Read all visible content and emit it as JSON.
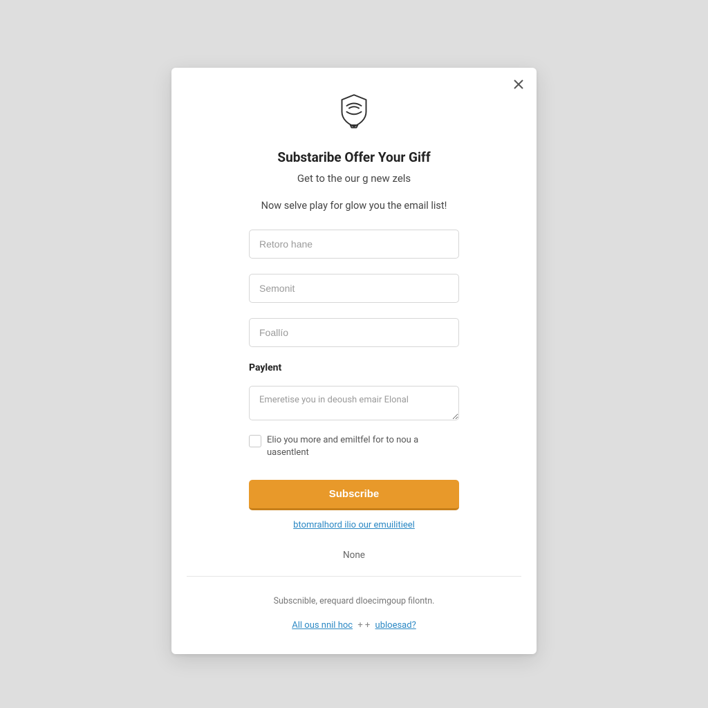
{
  "modal": {
    "title": "Substaribe Offer Your Giff",
    "subtitle": "Get to the our g new zels",
    "lead": "Now selve play for glow you the email list!",
    "fields": {
      "name_placeholder": "Retoro hane",
      "second_placeholder": "Semonit",
      "third_placeholder": "Foallío"
    },
    "section_label": "Paylent",
    "textarea_placeholder": "Emeretise you in deoush emair Elonal",
    "consent_label": "Elio you more and emiltfel for to nou a uasentlent",
    "subscribe_button": "Subscribe",
    "primary_link": "btomralhord ilio our emuilitieel",
    "none_text": "None",
    "footer_text": "Subscnible, erequard dloecimgoup filontn.",
    "footer_link_left": "All ous nnil hoc",
    "footer_link_right": "ubloesad?"
  }
}
